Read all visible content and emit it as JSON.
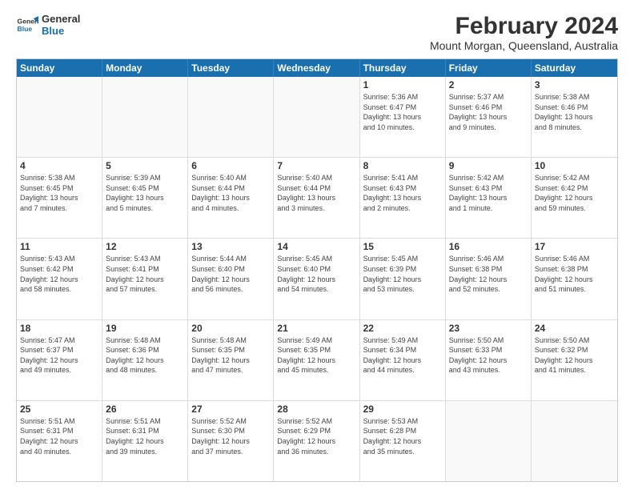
{
  "header": {
    "logo_line1": "General",
    "logo_line2": "Blue",
    "main_title": "February 2024",
    "subtitle": "Mount Morgan, Queensland, Australia"
  },
  "days_of_week": [
    "Sunday",
    "Monday",
    "Tuesday",
    "Wednesday",
    "Thursday",
    "Friday",
    "Saturday"
  ],
  "weeks": [
    [
      {
        "day": "",
        "info": ""
      },
      {
        "day": "",
        "info": ""
      },
      {
        "day": "",
        "info": ""
      },
      {
        "day": "",
        "info": ""
      },
      {
        "day": "1",
        "info": "Sunrise: 5:36 AM\nSunset: 6:47 PM\nDaylight: 13 hours\nand 10 minutes."
      },
      {
        "day": "2",
        "info": "Sunrise: 5:37 AM\nSunset: 6:46 PM\nDaylight: 13 hours\nand 9 minutes."
      },
      {
        "day": "3",
        "info": "Sunrise: 5:38 AM\nSunset: 6:46 PM\nDaylight: 13 hours\nand 8 minutes."
      }
    ],
    [
      {
        "day": "4",
        "info": "Sunrise: 5:38 AM\nSunset: 6:45 PM\nDaylight: 13 hours\nand 7 minutes."
      },
      {
        "day": "5",
        "info": "Sunrise: 5:39 AM\nSunset: 6:45 PM\nDaylight: 13 hours\nand 5 minutes."
      },
      {
        "day": "6",
        "info": "Sunrise: 5:40 AM\nSunset: 6:44 PM\nDaylight: 13 hours\nand 4 minutes."
      },
      {
        "day": "7",
        "info": "Sunrise: 5:40 AM\nSunset: 6:44 PM\nDaylight: 13 hours\nand 3 minutes."
      },
      {
        "day": "8",
        "info": "Sunrise: 5:41 AM\nSunset: 6:43 PM\nDaylight: 13 hours\nand 2 minutes."
      },
      {
        "day": "9",
        "info": "Sunrise: 5:42 AM\nSunset: 6:43 PM\nDaylight: 13 hours\nand 1 minute."
      },
      {
        "day": "10",
        "info": "Sunrise: 5:42 AM\nSunset: 6:42 PM\nDaylight: 12 hours\nand 59 minutes."
      }
    ],
    [
      {
        "day": "11",
        "info": "Sunrise: 5:43 AM\nSunset: 6:42 PM\nDaylight: 12 hours\nand 58 minutes."
      },
      {
        "day": "12",
        "info": "Sunrise: 5:43 AM\nSunset: 6:41 PM\nDaylight: 12 hours\nand 57 minutes."
      },
      {
        "day": "13",
        "info": "Sunrise: 5:44 AM\nSunset: 6:40 PM\nDaylight: 12 hours\nand 56 minutes."
      },
      {
        "day": "14",
        "info": "Sunrise: 5:45 AM\nSunset: 6:40 PM\nDaylight: 12 hours\nand 54 minutes."
      },
      {
        "day": "15",
        "info": "Sunrise: 5:45 AM\nSunset: 6:39 PM\nDaylight: 12 hours\nand 53 minutes."
      },
      {
        "day": "16",
        "info": "Sunrise: 5:46 AM\nSunset: 6:38 PM\nDaylight: 12 hours\nand 52 minutes."
      },
      {
        "day": "17",
        "info": "Sunrise: 5:46 AM\nSunset: 6:38 PM\nDaylight: 12 hours\nand 51 minutes."
      }
    ],
    [
      {
        "day": "18",
        "info": "Sunrise: 5:47 AM\nSunset: 6:37 PM\nDaylight: 12 hours\nand 49 minutes."
      },
      {
        "day": "19",
        "info": "Sunrise: 5:48 AM\nSunset: 6:36 PM\nDaylight: 12 hours\nand 48 minutes."
      },
      {
        "day": "20",
        "info": "Sunrise: 5:48 AM\nSunset: 6:35 PM\nDaylight: 12 hours\nand 47 minutes."
      },
      {
        "day": "21",
        "info": "Sunrise: 5:49 AM\nSunset: 6:35 PM\nDaylight: 12 hours\nand 45 minutes."
      },
      {
        "day": "22",
        "info": "Sunrise: 5:49 AM\nSunset: 6:34 PM\nDaylight: 12 hours\nand 44 minutes."
      },
      {
        "day": "23",
        "info": "Sunrise: 5:50 AM\nSunset: 6:33 PM\nDaylight: 12 hours\nand 43 minutes."
      },
      {
        "day": "24",
        "info": "Sunrise: 5:50 AM\nSunset: 6:32 PM\nDaylight: 12 hours\nand 41 minutes."
      }
    ],
    [
      {
        "day": "25",
        "info": "Sunrise: 5:51 AM\nSunset: 6:31 PM\nDaylight: 12 hours\nand 40 minutes."
      },
      {
        "day": "26",
        "info": "Sunrise: 5:51 AM\nSunset: 6:31 PM\nDaylight: 12 hours\nand 39 minutes."
      },
      {
        "day": "27",
        "info": "Sunrise: 5:52 AM\nSunset: 6:30 PM\nDaylight: 12 hours\nand 37 minutes."
      },
      {
        "day": "28",
        "info": "Sunrise: 5:52 AM\nSunset: 6:29 PM\nDaylight: 12 hours\nand 36 minutes."
      },
      {
        "day": "29",
        "info": "Sunrise: 5:53 AM\nSunset: 6:28 PM\nDaylight: 12 hours\nand 35 minutes."
      },
      {
        "day": "",
        "info": ""
      },
      {
        "day": "",
        "info": ""
      }
    ]
  ]
}
